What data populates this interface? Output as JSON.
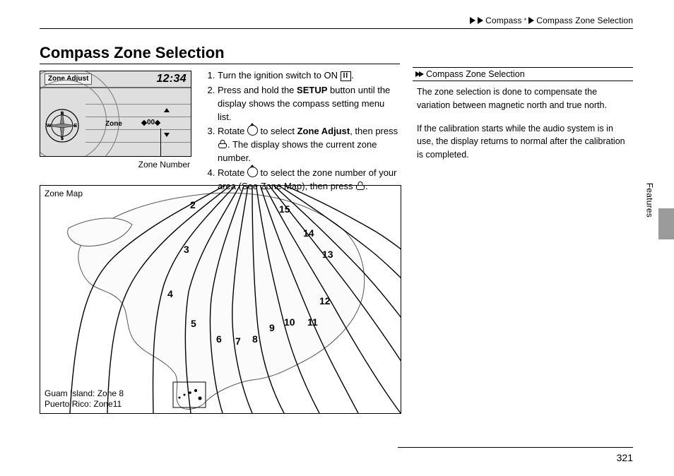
{
  "breadcrumb": {
    "a": "Compass",
    "star": "*",
    "b": "Compass Zone Selection"
  },
  "title": "Compass Zone Selection",
  "display": {
    "zone_adjust_label": "Zone Adjust",
    "time": "12:34",
    "zone_label": "Zone",
    "zone_value": "00",
    "caption": "Zone Number",
    "compass_letters": {
      "n": "N",
      "e": "E",
      "s": "S",
      "w": "W"
    }
  },
  "steps": {
    "s1a": "Turn the ignition switch to ON ",
    "s1_ii": "II",
    "s1b": ".",
    "s2a": "Press and hold the ",
    "s2_bold": "SETUP",
    "s2b": " button until the display shows the compass setting menu list.",
    "s3a": "Rotate ",
    "s3b": " to select ",
    "s3_bold": "Zone Adjust",
    "s3c": ", then press ",
    "s3d": ". The display shows the current zone number.",
    "s4a": "Rotate ",
    "s4b": " to select the zone number of your area (See Zone Map), then press ",
    "s4c": "."
  },
  "notes": {
    "header": "Compass Zone Selection",
    "p1": "The zone selection is done to compensate the variation between magnetic north and true north.",
    "p2": "If the calibration starts while the audio system is in use, the display returns to normal after the calibration is completed."
  },
  "map": {
    "caption_tl": "Zone Map",
    "guam": "Guam Island: Zone 8",
    "pr": "Puerto Rico: Zone11",
    "zones": [
      "2",
      "3",
      "4",
      "5",
      "6",
      "7",
      "8",
      "9",
      "10",
      "11",
      "12",
      "13",
      "14",
      "15"
    ]
  },
  "section_tab": "Features",
  "page_number": "321"
}
